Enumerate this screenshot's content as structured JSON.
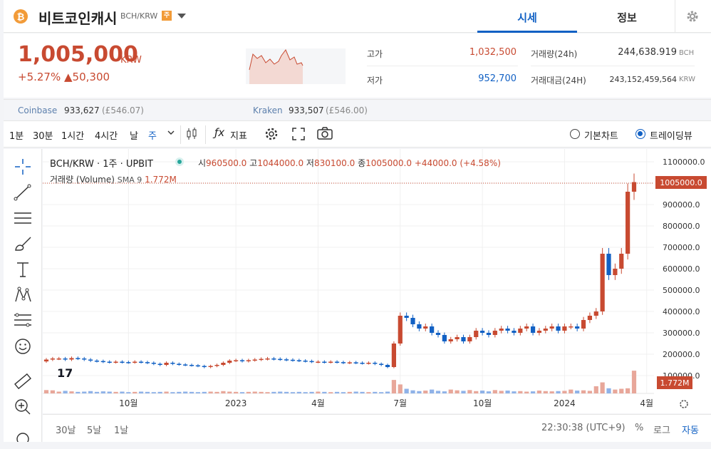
{
  "header": {
    "coin_name": "비트코인캐시",
    "pair": "BCH/KRW",
    "badge": "주",
    "tabs": [
      {
        "label": "시세"
      },
      {
        "label": "정보"
      }
    ]
  },
  "summary": {
    "price": "1,005,000",
    "unit": "KRW",
    "change_pct": "+5.27%",
    "change_abs": "▲50,300",
    "high_label": "고가",
    "high": "1,032,500",
    "low_label": "저가",
    "low": "952,700",
    "volume_label": "거래량(24h)",
    "volume": "244,638.919",
    "volume_unit": "BCH",
    "amount_label": "거래대금(24H)",
    "amount": "243,152,459,564",
    "amount_unit": "KRW",
    "colors": {
      "up": "#c84a31",
      "down": "#1261c4"
    }
  },
  "exchanges": [
    {
      "name": "Coinbase",
      "price": "933,627",
      "gbp": "(£546.07)"
    },
    {
      "name": "Kraken",
      "price": "933,507",
      "gbp": "(£546.00)"
    }
  ],
  "toolbar": {
    "intervals": [
      "1분",
      "30분",
      "1시간",
      "4시간",
      "날",
      "주"
    ],
    "active_interval": "주",
    "indicator_label": "지표",
    "basic_chart": "기본차트",
    "trading_view": "트레이딩뷰"
  },
  "bottom": {
    "ranges": [
      "30날",
      "5날",
      "1날"
    ],
    "clock": "22:30:38 (UTC+9)",
    "pct": "%",
    "log": "로그",
    "auto": "자동"
  },
  "chart_data": {
    "type": "candlestick",
    "title": "BCH/KRW · 1주 · UPBIT",
    "ohlc_legend": {
      "o_label": "시",
      "o": "960500.0",
      "h_label": "고",
      "h": "1044000.0",
      "l_label": "저",
      "l": "830100.0",
      "c_label": "종",
      "c": "1005000.0",
      "chg": "+44000.0",
      "chg_pct": "(+4.58%)"
    },
    "volume_legend": {
      "label": "거래량 (Volume)",
      "sma": "SMA 9",
      "value": "1.772M"
    },
    "last_price_label": "1005000.0",
    "last_volume_label": "1.772M",
    "y_ticks": [
      100000,
      200000,
      300000,
      400000,
      500000,
      600000,
      700000,
      800000,
      900000,
      1000000,
      1100000
    ],
    "y_tick_labels": [
      "100000.0",
      "200000.0",
      "300000.0",
      "400000.0",
      "500000.0",
      "600000.0",
      "700000.0",
      "800000.0",
      "900000.0",
      "1000000.0",
      "1100000.0"
    ],
    "x_tick_labels": [
      {
        "label": "10월",
        "index": 13
      },
      {
        "label": "2023",
        "index": 30
      },
      {
        "label": "4월",
        "index": 43
      },
      {
        "label": "7월",
        "index": 56
      },
      {
        "label": "10월",
        "index": 69
      },
      {
        "label": "2024",
        "index": 82
      },
      {
        "label": "4월",
        "index": 95
      }
    ],
    "colors": {
      "up": "#c84a31",
      "down": "#1261c4",
      "vol_up": "#e8a79a",
      "vol_down": "#8fb2e8"
    },
    "closes": [
      175000,
      180000,
      180000,
      175000,
      182000,
      180000,
      175000,
      170000,
      168000,
      165000,
      163000,
      165000,
      163000,
      162000,
      165000,
      163000,
      160000,
      155000,
      150000,
      160000,
      155000,
      152000,
      150000,
      148000,
      145000,
      140000,
      145000,
      150000,
      160000,
      170000,
      172000,
      168000,
      172000,
      175000,
      178000,
      180000,
      178000,
      176000,
      174000,
      172000,
      170000,
      168000,
      165000,
      165000,
      163000,
      165000,
      163000,
      160000,
      162000,
      160000,
      158000,
      160000,
      155000,
      150000,
      140000,
      250000,
      380000,
      370000,
      340000,
      320000,
      330000,
      300000,
      290000,
      260000,
      270000,
      280000,
      260000,
      280000,
      310000,
      300000,
      290000,
      310000,
      320000,
      310000,
      300000,
      320000,
      330000,
      300000,
      310000,
      320000,
      330000,
      310000,
      330000,
      330000,
      320000,
      360000,
      380000,
      400000,
      670000,
      570000,
      600000,
      670000,
      960000,
      1005000
    ],
    "volumes": [
      0.26,
      0.24,
      0.14,
      0.2,
      0.16,
      0.12,
      0.14,
      0.18,
      0.12,
      0.16,
      0.14,
      0.12,
      0.14,
      0.1,
      0.12,
      0.14,
      0.12,
      0.1,
      0.12,
      0.14,
      0.1,
      0.12,
      0.14,
      0.12,
      0.1,
      0.12,
      0.14,
      0.12,
      0.18,
      0.14,
      0.12,
      0.1,
      0.12,
      0.14,
      0.12,
      0.1,
      0.12,
      0.14,
      0.12,
      0.1,
      0.12,
      0.1,
      0.12,
      0.14,
      0.12,
      0.1,
      0.12,
      0.1,
      0.12,
      0.14,
      0.12,
      0.1,
      0.12,
      0.1,
      0.14,
      1.05,
      0.7,
      0.36,
      0.24,
      0.18,
      0.22,
      0.3,
      0.2,
      0.16,
      0.3,
      0.24,
      0.2,
      0.26,
      0.18,
      0.22,
      0.16,
      0.26,
      0.2,
      0.22,
      0.16,
      0.18,
      0.14,
      0.16,
      0.22,
      0.18,
      0.16,
      0.18,
      0.2,
      0.3,
      0.22,
      0.24,
      0.2,
      0.56,
      0.86,
      0.4,
      0.3,
      0.36,
      0.4,
      1.772
    ]
  }
}
